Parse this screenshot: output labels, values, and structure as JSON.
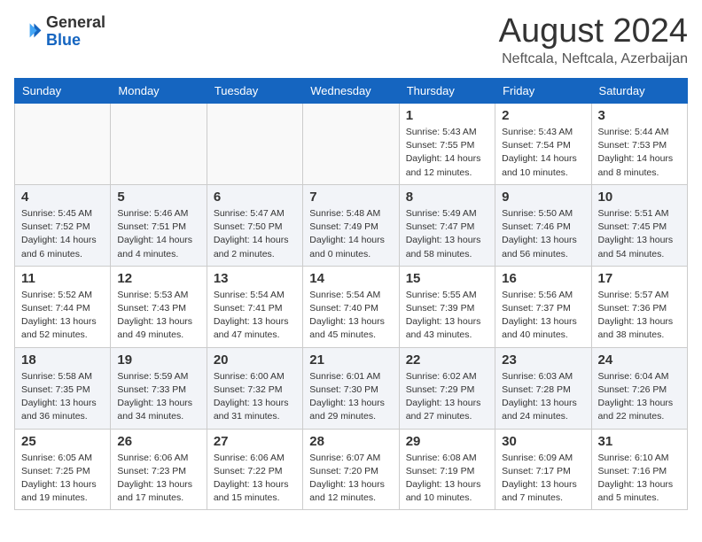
{
  "logo": {
    "line1": "General",
    "line2": "Blue"
  },
  "title": "August 2024",
  "location": "Neftcala, Neftcala, Azerbaijan",
  "days_of_week": [
    "Sunday",
    "Monday",
    "Tuesday",
    "Wednesday",
    "Thursday",
    "Friday",
    "Saturday"
  ],
  "weeks": [
    [
      {
        "day": "",
        "content": ""
      },
      {
        "day": "",
        "content": ""
      },
      {
        "day": "",
        "content": ""
      },
      {
        "day": "",
        "content": ""
      },
      {
        "day": "1",
        "content": "Sunrise: 5:43 AM\nSunset: 7:55 PM\nDaylight: 14 hours\nand 12 minutes."
      },
      {
        "day": "2",
        "content": "Sunrise: 5:43 AM\nSunset: 7:54 PM\nDaylight: 14 hours\nand 10 minutes."
      },
      {
        "day": "3",
        "content": "Sunrise: 5:44 AM\nSunset: 7:53 PM\nDaylight: 14 hours\nand 8 minutes."
      }
    ],
    [
      {
        "day": "4",
        "content": "Sunrise: 5:45 AM\nSunset: 7:52 PM\nDaylight: 14 hours\nand 6 minutes."
      },
      {
        "day": "5",
        "content": "Sunrise: 5:46 AM\nSunset: 7:51 PM\nDaylight: 14 hours\nand 4 minutes."
      },
      {
        "day": "6",
        "content": "Sunrise: 5:47 AM\nSunset: 7:50 PM\nDaylight: 14 hours\nand 2 minutes."
      },
      {
        "day": "7",
        "content": "Sunrise: 5:48 AM\nSunset: 7:49 PM\nDaylight: 14 hours\nand 0 minutes."
      },
      {
        "day": "8",
        "content": "Sunrise: 5:49 AM\nSunset: 7:47 PM\nDaylight: 13 hours\nand 58 minutes."
      },
      {
        "day": "9",
        "content": "Sunrise: 5:50 AM\nSunset: 7:46 PM\nDaylight: 13 hours\nand 56 minutes."
      },
      {
        "day": "10",
        "content": "Sunrise: 5:51 AM\nSunset: 7:45 PM\nDaylight: 13 hours\nand 54 minutes."
      }
    ],
    [
      {
        "day": "11",
        "content": "Sunrise: 5:52 AM\nSunset: 7:44 PM\nDaylight: 13 hours\nand 52 minutes."
      },
      {
        "day": "12",
        "content": "Sunrise: 5:53 AM\nSunset: 7:43 PM\nDaylight: 13 hours\nand 49 minutes."
      },
      {
        "day": "13",
        "content": "Sunrise: 5:54 AM\nSunset: 7:41 PM\nDaylight: 13 hours\nand 47 minutes."
      },
      {
        "day": "14",
        "content": "Sunrise: 5:54 AM\nSunset: 7:40 PM\nDaylight: 13 hours\nand 45 minutes."
      },
      {
        "day": "15",
        "content": "Sunrise: 5:55 AM\nSunset: 7:39 PM\nDaylight: 13 hours\nand 43 minutes."
      },
      {
        "day": "16",
        "content": "Sunrise: 5:56 AM\nSunset: 7:37 PM\nDaylight: 13 hours\nand 40 minutes."
      },
      {
        "day": "17",
        "content": "Sunrise: 5:57 AM\nSunset: 7:36 PM\nDaylight: 13 hours\nand 38 minutes."
      }
    ],
    [
      {
        "day": "18",
        "content": "Sunrise: 5:58 AM\nSunset: 7:35 PM\nDaylight: 13 hours\nand 36 minutes."
      },
      {
        "day": "19",
        "content": "Sunrise: 5:59 AM\nSunset: 7:33 PM\nDaylight: 13 hours\nand 34 minutes."
      },
      {
        "day": "20",
        "content": "Sunrise: 6:00 AM\nSunset: 7:32 PM\nDaylight: 13 hours\nand 31 minutes."
      },
      {
        "day": "21",
        "content": "Sunrise: 6:01 AM\nSunset: 7:30 PM\nDaylight: 13 hours\nand 29 minutes."
      },
      {
        "day": "22",
        "content": "Sunrise: 6:02 AM\nSunset: 7:29 PM\nDaylight: 13 hours\nand 27 minutes."
      },
      {
        "day": "23",
        "content": "Sunrise: 6:03 AM\nSunset: 7:28 PM\nDaylight: 13 hours\nand 24 minutes."
      },
      {
        "day": "24",
        "content": "Sunrise: 6:04 AM\nSunset: 7:26 PM\nDaylight: 13 hours\nand 22 minutes."
      }
    ],
    [
      {
        "day": "25",
        "content": "Sunrise: 6:05 AM\nSunset: 7:25 PM\nDaylight: 13 hours\nand 19 minutes."
      },
      {
        "day": "26",
        "content": "Sunrise: 6:06 AM\nSunset: 7:23 PM\nDaylight: 13 hours\nand 17 minutes."
      },
      {
        "day": "27",
        "content": "Sunrise: 6:06 AM\nSunset: 7:22 PM\nDaylight: 13 hours\nand 15 minutes."
      },
      {
        "day": "28",
        "content": "Sunrise: 6:07 AM\nSunset: 7:20 PM\nDaylight: 13 hours\nand 12 minutes."
      },
      {
        "day": "29",
        "content": "Sunrise: 6:08 AM\nSunset: 7:19 PM\nDaylight: 13 hours\nand 10 minutes."
      },
      {
        "day": "30",
        "content": "Sunrise: 6:09 AM\nSunset: 7:17 PM\nDaylight: 13 hours\nand 7 minutes."
      },
      {
        "day": "31",
        "content": "Sunrise: 6:10 AM\nSunset: 7:16 PM\nDaylight: 13 hours\nand 5 minutes."
      }
    ]
  ]
}
